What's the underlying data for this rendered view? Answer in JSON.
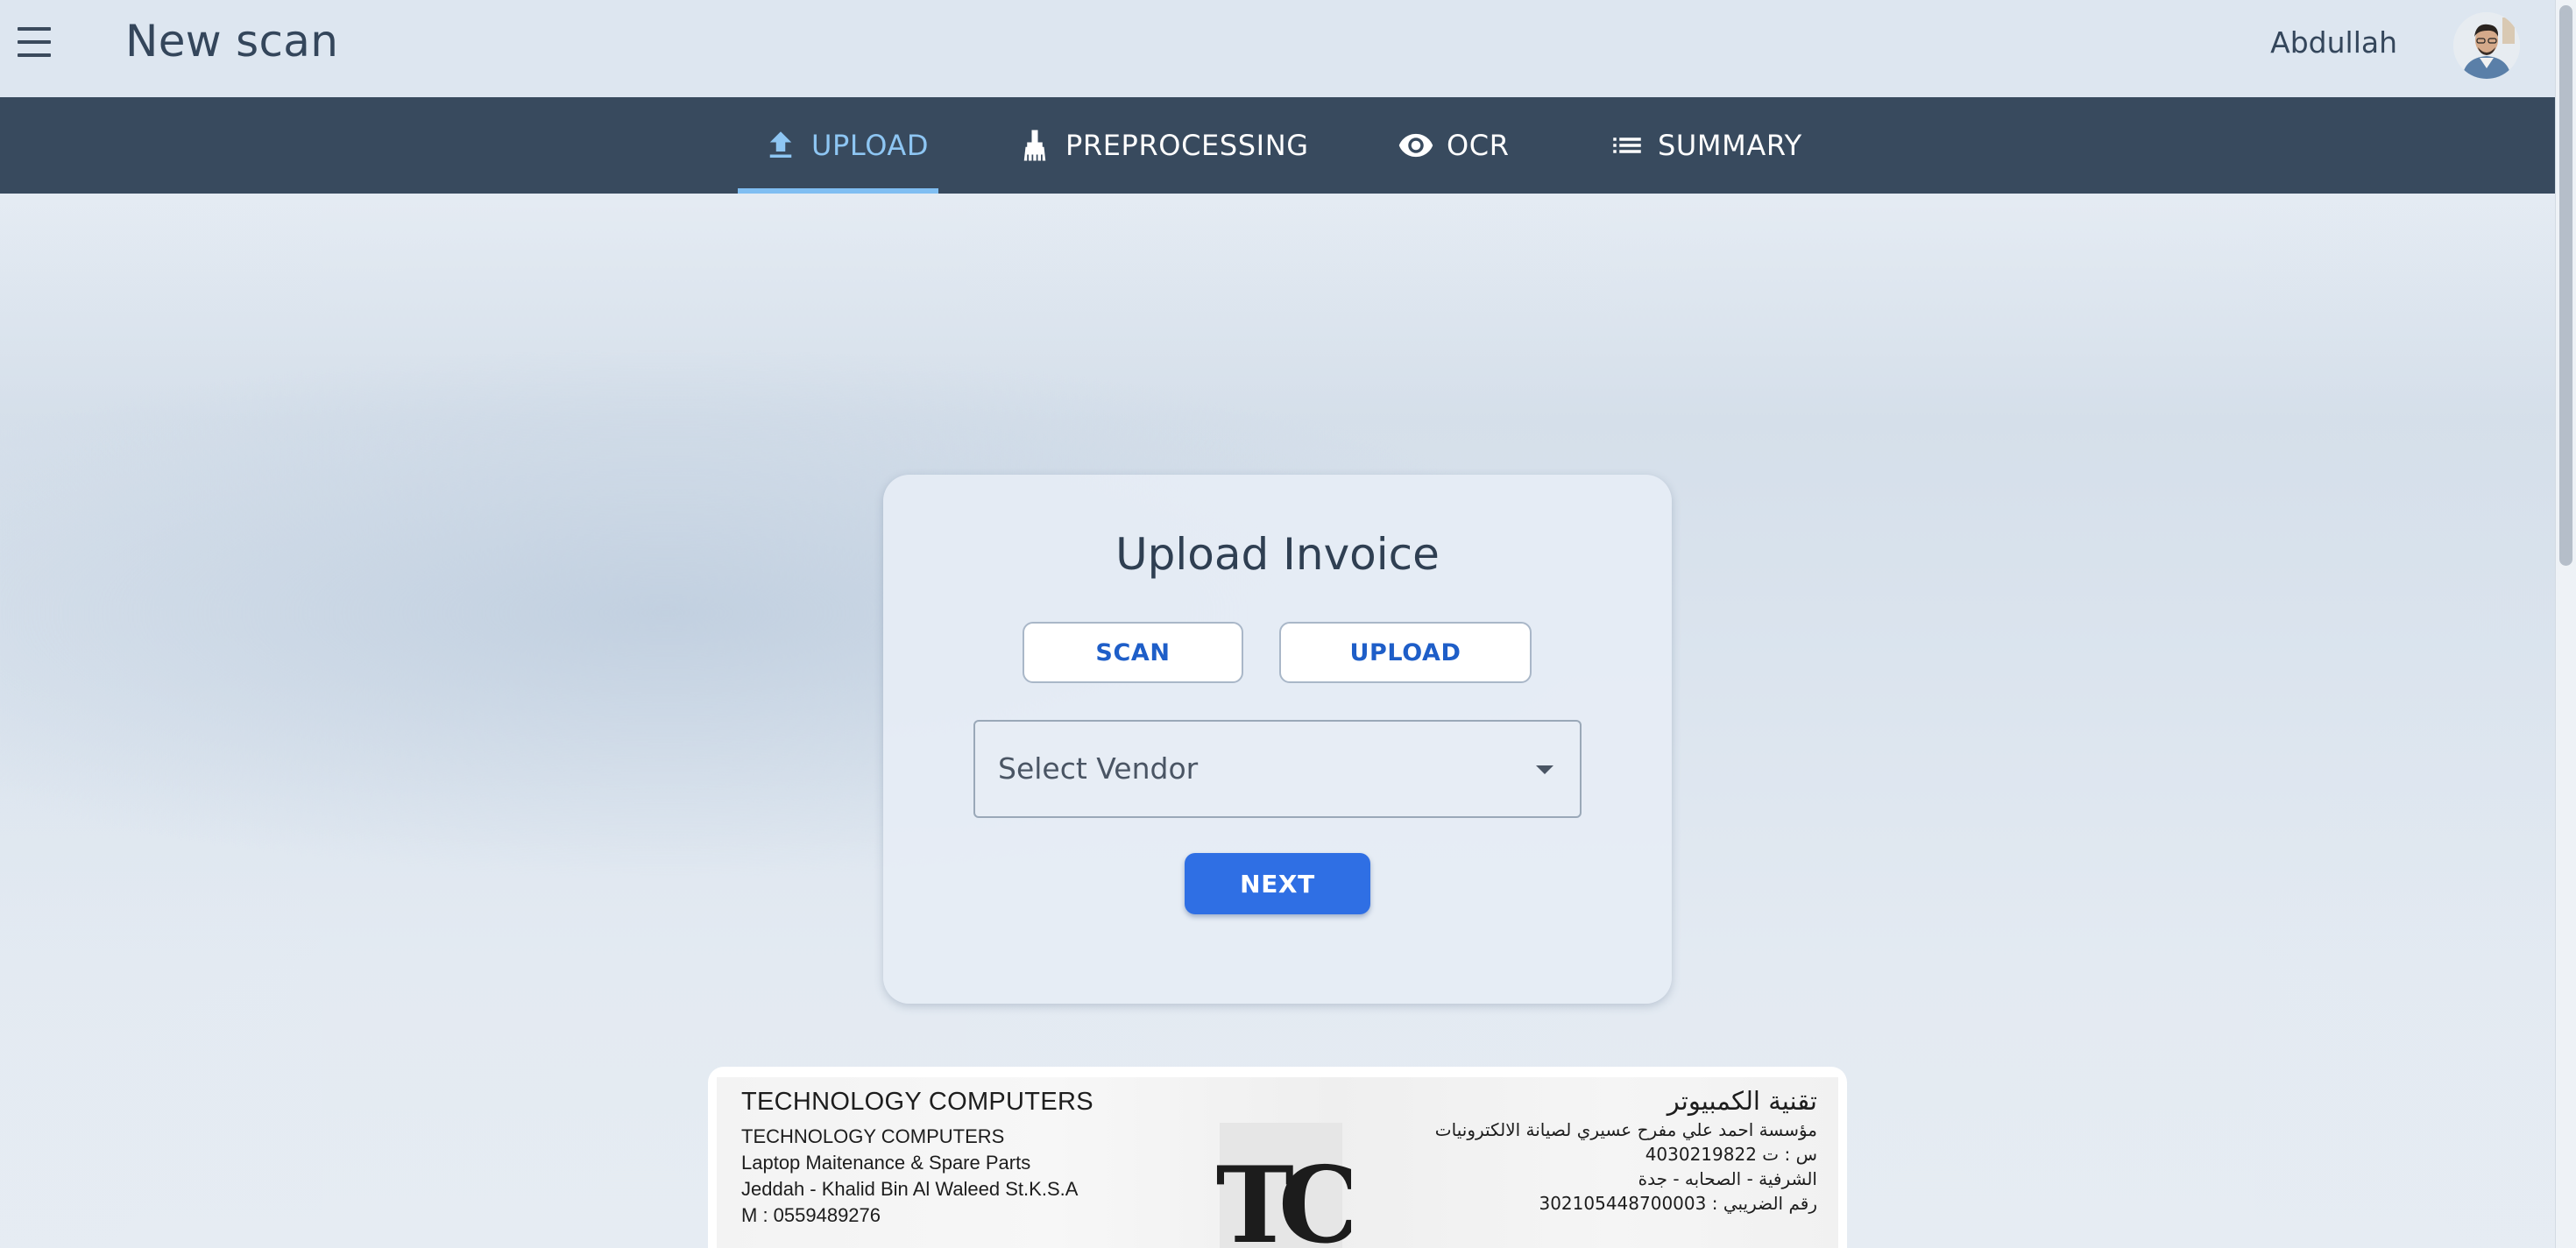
{
  "header": {
    "title": "New scan",
    "user_name": "Abdullah"
  },
  "tabs": [
    {
      "label": "UPLOAD",
      "icon": "upload-icon",
      "active": true
    },
    {
      "label": "PREPROCESSING",
      "icon": "broom-icon",
      "active": false
    },
    {
      "label": "OCR",
      "icon": "eye-icon",
      "active": false
    },
    {
      "label": "SUMMARY",
      "icon": "list-icon",
      "active": false
    }
  ],
  "card": {
    "title": "Upload Invoice",
    "scan_label": "SCAN",
    "upload_label": "UPLOAD",
    "vendor_placeholder": "Select Vendor",
    "next_label": "NEXT"
  },
  "invoice": {
    "en": [
      "TECHNOLOGY COMPUTERS",
      "TECHNOLOGY COMPUTERS",
      "Laptop Maitenance & Spare Parts",
      "Jeddah - Khalid Bin Al Waleed St.K.S.A",
      "M : 0559489276"
    ],
    "ar": [
      "تقنية الكمبيوتر",
      "مؤسسة احمد علي مفرح عسيري لصيانة الالكترونيات",
      "س : ت 4030219822",
      "الشرفية - الصحابه - جدة",
      "رقم الضريبي : 302105448700003"
    ],
    "logo_text": "TC"
  },
  "colors": {
    "tabbar": "#384a5e",
    "active_tab": "#8ec6f3",
    "primary_button": "#2f6fe4",
    "outline_text": "#1e5ec8"
  }
}
